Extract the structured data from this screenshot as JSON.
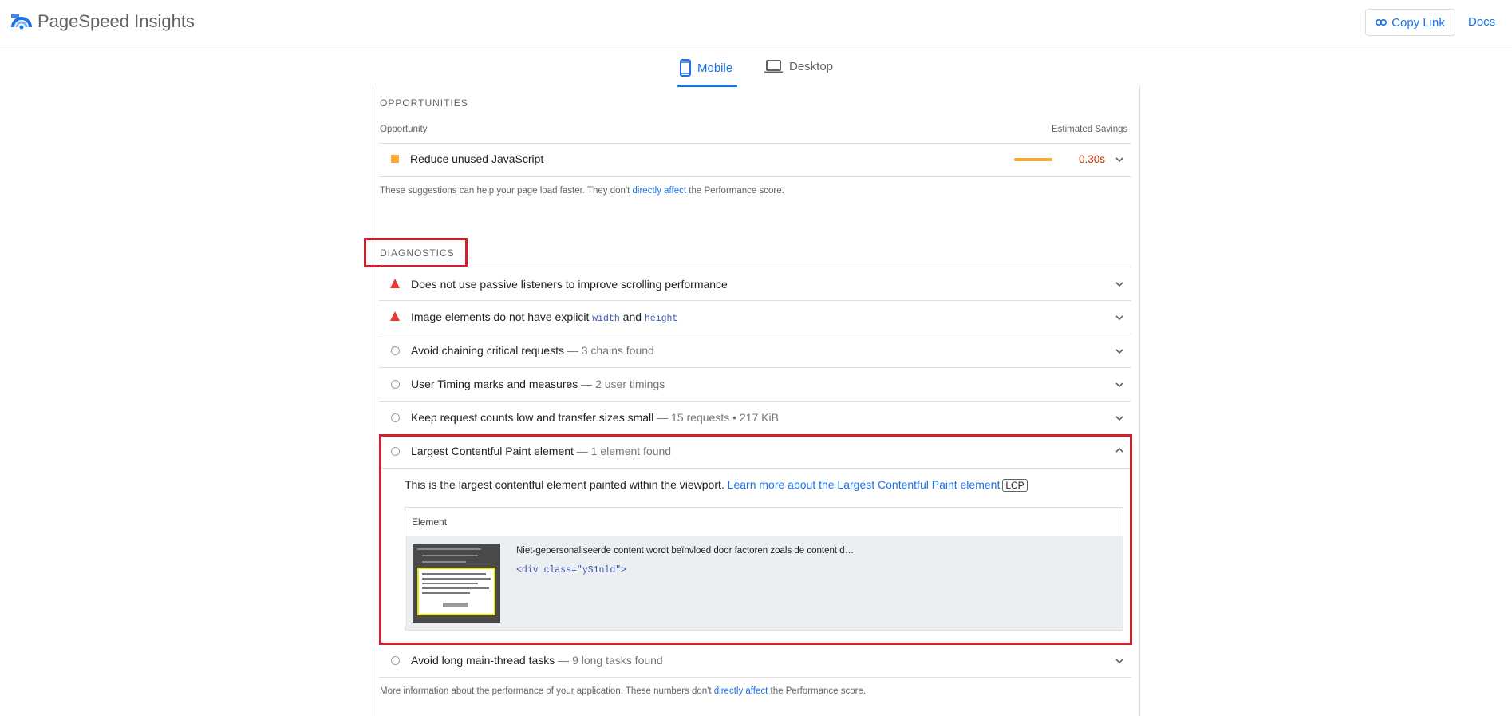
{
  "header": {
    "brand": "PageSpeed Insights",
    "copy_link": "Copy Link",
    "docs": "Docs"
  },
  "tabs": {
    "mobile": "Mobile",
    "desktop": "Desktop",
    "active": "mobile"
  },
  "opportunities": {
    "title": "OPPORTUNITIES",
    "col_left": "Opportunity",
    "col_right": "Estimated Savings",
    "item": {
      "label": "Reduce unused JavaScript",
      "savings": "0.30s"
    },
    "footnote_pre": "These suggestions can help your page load faster. They don't ",
    "footnote_link": "directly affect",
    "footnote_post": " the Performance score."
  },
  "diagnostics": {
    "title": "DIAGNOSTICS",
    "items": [
      {
        "label": "Does not use passive listeners to improve scrolling performance",
        "meta": "",
        "status": "fail"
      },
      {
        "label_pre": "Image elements do not have explicit ",
        "code1": "width",
        "mid": " and ",
        "code2": "height",
        "status": "fail"
      },
      {
        "label": "Avoid chaining critical requests",
        "meta": " — 3 chains found",
        "status": "neutral"
      },
      {
        "label": "User Timing marks and measures",
        "meta": " — 2 user timings",
        "status": "neutral"
      },
      {
        "label": "Keep request counts low and transfer sizes small",
        "meta": " — 15 requests • 217 KiB",
        "status": "neutral"
      },
      {
        "label": "Largest Contentful Paint element",
        "meta": " — 1 element found",
        "status": "neutral",
        "expanded": true
      },
      {
        "label": "Avoid long main-thread tasks",
        "meta": " — 9 long tasks found",
        "status": "neutral"
      }
    ],
    "lcp_detail": {
      "desc": "This is the largest contentful element painted within the viewport. ",
      "learn_more": "Learn more about the Largest Contentful Paint element",
      "badge": "LCP",
      "table_header": "Element",
      "snippet": "Niet-gepersonaliseerde content wordt beïnvloed door factoren zoals de content d…",
      "code": "<div class=\"yS1nld\">"
    },
    "footnote_pre": "More information about the performance of your application. These numbers don't ",
    "footnote_link": "directly affect",
    "footnote_post": " the Performance score."
  },
  "colors": {
    "accent": "#1a73e8",
    "fail": "#e53935",
    "average": "#fbaa35",
    "highlight": "#d0202e"
  }
}
